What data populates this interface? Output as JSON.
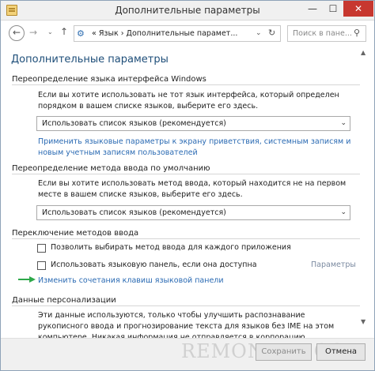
{
  "window": {
    "title": "Дополнительные параметры",
    "controls": {
      "minimize": "—",
      "maximize": "☐",
      "close": "✕"
    }
  },
  "navbar": {
    "back_glyph": "←",
    "forward_glyph": "→",
    "dropdown_glyph": "⌄",
    "up_glyph": "↑",
    "address_icon": "control-panel-icon",
    "address_text": "« Язык › Дополнительные парамет...",
    "address_dropdown_glyph": "⌄",
    "refresh_glyph": "↻",
    "search_placeholder": "Поиск в пане...",
    "search_icon_glyph": "⚲"
  },
  "content": {
    "page_title": "Дополнительные параметры",
    "scroll_up_glyph": "▲",
    "scroll_down_glyph": "▼",
    "override_ui": {
      "title": "Переопределение языка интерфейса Windows",
      "description": "Если вы хотите использовать не тот язык интерфейса, который определен порядком в вашем списке языков, выберите его здесь.",
      "select_value": "Использовать список языков (рекомендуется)",
      "link": "Применить языковые параметры к экрану приветствия, системным записям и новым учетным записям пользователей"
    },
    "override_input": {
      "title": "Переопределение метода ввода по умолчанию",
      "description": "Если вы хотите использовать метод ввода, который находится не на первом месте в вашем списке языков, выберите его здесь.",
      "select_value": "Использовать список языков (рекомендуется)"
    },
    "switching": {
      "title": "Переключение методов ввода",
      "checkbox1": "Позволить выбирать метод ввода для каждого приложения",
      "checkbox2": "Использовать языковую панель, если она доступна",
      "params_link": "Параметры",
      "shortcut_link": "Изменить сочетания клавиш языковой панели"
    },
    "personalization": {
      "title": "Данные персонализации",
      "description": "Эти данные используются, только чтобы улучшить распознавание рукописного ввода и прогнозирование текста для языков без IME на этом компьютере. Никакая информация не отправляется в корпорацию Майкрософт. Заявление о конфиденциальности"
    }
  },
  "footer": {
    "watermark": "REMONTKA.COM",
    "save_label": "Сохранить",
    "cancel_label": "Отмена"
  },
  "colors": {
    "link": "#2a6ab3",
    "title": "#1e4e79",
    "close_button": "#c7372f",
    "arrow": "#2ea84a"
  }
}
